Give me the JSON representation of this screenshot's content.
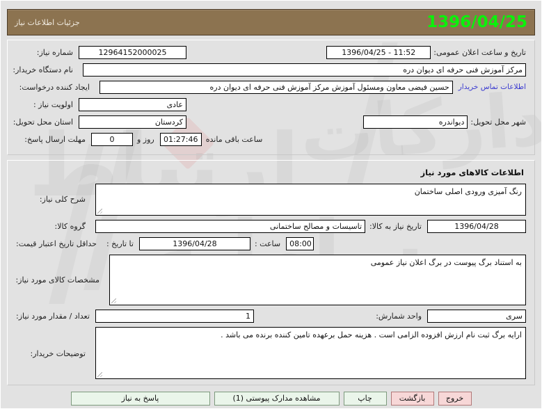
{
  "header": {
    "date": "1396/04/25",
    "title": "جزئیات اطلاعات نیاز"
  },
  "request_info": {
    "need_number_label": "شماره نیاز:",
    "need_number_value": "12964152000025",
    "announce_datetime_label": "تاریخ و ساعت اعلان عمومی:",
    "announce_datetime_value": "1396/04/25 - 11:52",
    "buyer_org_label": "نام دستگاه خریدار:",
    "buyer_org_value": "مرکز آموزش فنی حرفه ای دیوان دره",
    "requester_label": "ایجاد کننده درخواست:",
    "requester_value": "حسین فیضی معاون ومسئول آموزش مرکز آموزش فنی حرفه ای دیوان دره",
    "contact_link": "اطلاعات تماس خریدار",
    "priority_label": "اولویت نیاز :",
    "priority_value": "عادی",
    "province_label": "استان محل تحویل:",
    "province_value": "کردستان",
    "city_label": "شهر محل تحویل:",
    "city_value": "دیواندره",
    "deadline_label": "مهلت ارسال پاسخ:",
    "deadline_days": "0",
    "deadline_days_unit": "روز و",
    "deadline_time": "01:27:46",
    "deadline_suffix": "ساعت باقی مانده"
  },
  "goods_info": {
    "section_title": "اطلاعات کالاهای مورد نیاز",
    "general_desc_label": "شرح کلی نیاز:",
    "general_desc_value": "رنگ آمیزی ورودی اصلی ساختمان",
    "goods_group_label": "گروه کالا:",
    "goods_group_value": "تاسیسات و مصالح ساختمانی",
    "need_date_label": "تاریخ نیاز به کالا:",
    "need_date_value": "1396/04/28",
    "price_validity_label": "حداقل تاریخ اعتبار قیمت:",
    "until_date_label": "تا تاریخ :",
    "until_date_value": "1396/04/28",
    "time_label": "ساعت :",
    "time_value": "08:00",
    "specs_label": "مشخصات کالای مورد نیاز:",
    "specs_value": "به استناد برگ پیوست در برگ اعلان نیاز عمومی",
    "quantity_label": "تعداد / مقدار مورد نیاز:",
    "quantity_value": "1",
    "unit_label": "واحد شمارش:",
    "unit_value": "سری",
    "buyer_notes_label": "توضیحات خریدار:",
    "buyer_notes_value": "ارایه برگ ثبت نام ارزش افزوده الزامی است . هزینه حمل برعهده تامین کننده برنده می باشد ."
  },
  "footer": {
    "respond_label": "پاسخ به نیاز",
    "attachments_label": "مشاهده مدارک پیوستی (1)",
    "print_label": "چاپ",
    "back_label": "بازگشت",
    "exit_label": "خروج"
  },
  "colors": {
    "titlebar_bg": "#8c7350",
    "date_text": "#0bf20b",
    "page_bg": "#e2e2e2",
    "link": "#3a3ad0",
    "btn_green": "#eaf5ea",
    "btn_pink": "#f7d7d7"
  }
}
